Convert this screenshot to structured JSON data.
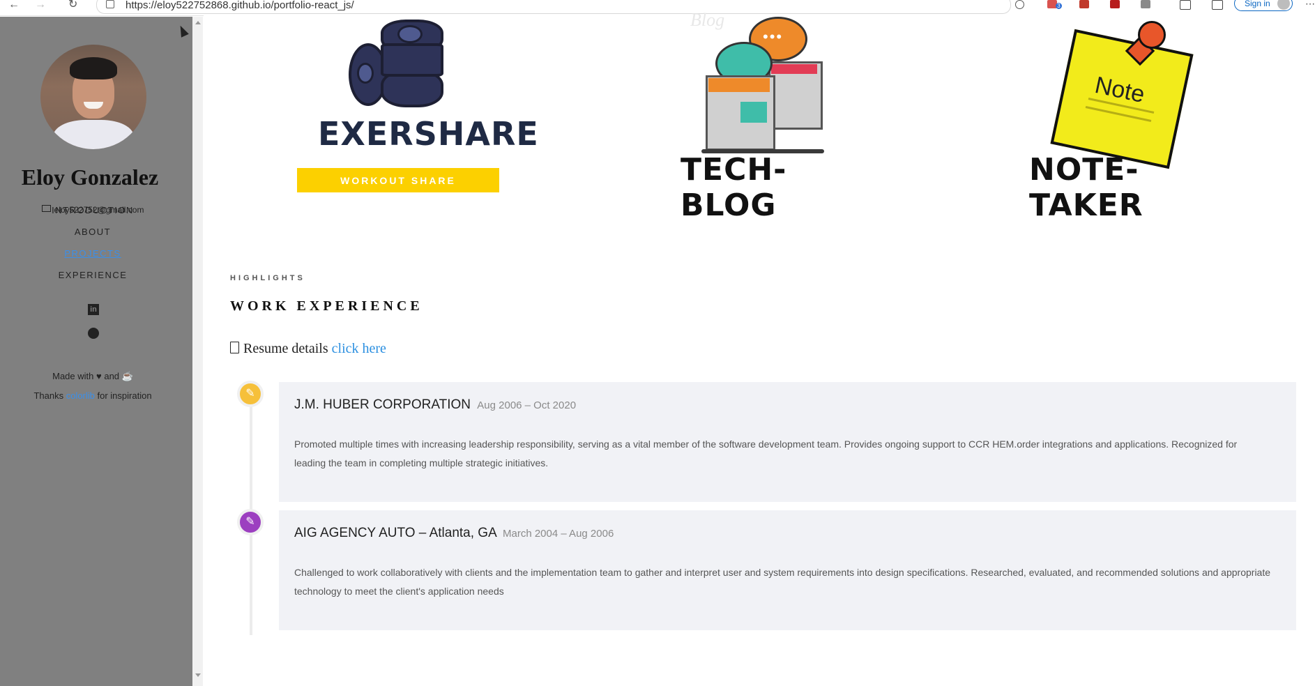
{
  "browser": {
    "url": "https://eloy522752868.github.io/portfolio-react_js/",
    "signin_label": "Sign in",
    "badge_count": "3"
  },
  "sidebar": {
    "name": "Eloy Gonzalez",
    "email": "eloy522752@gmail.com",
    "nav": [
      {
        "label": "INTRODUCTION",
        "active": false
      },
      {
        "label": "ABOUT",
        "active": false
      },
      {
        "label": "PROJECTS",
        "active": true
      },
      {
        "label": "EXPERIENCE",
        "active": false
      }
    ],
    "social": {
      "linkedin_glyph": "in",
      "github_glyph": "●"
    },
    "made_with_prefix": "Made with",
    "made_with_and": "and",
    "thanks_prefix": "Thanks",
    "thanks_link": "colorlib",
    "thanks_suffix": "for inspiration"
  },
  "projects": {
    "exershare_title": "EXERSHARE",
    "exershare_sub": "WORKOUT SHARE",
    "techblog_title": "TECH-BLOG",
    "notetaker_title": "NOTE-TAKER",
    "note_label": "Note",
    "blog_watermark": "Blog"
  },
  "experience_section": {
    "kicker": "HIGHLIGHTS",
    "title": "WORK EXPERIENCE",
    "resume_text": "Resume details",
    "resume_link": "click here",
    "entries": [
      {
        "company": "J.M. HUBER CORPORATION",
        "dates": "Aug 2006 – Oct 2020",
        "description": "Promoted multiple times with increasing leadership responsibility, serving as a vital member of the software development team. Provides ongoing support to CCR HEM.order integrations and applications. Recognized for leading the team in completing multiple strategic initiatives.",
        "icon_color": "#f6c03a",
        "icon_glyph": "✎"
      },
      {
        "company": "AIG AGENCY AUTO – Atlanta, GA",
        "dates": "March 2004 – Aug 2006",
        "description": "Challenged to work collaboratively with clients and the implementation team to gather and interpret user and system requirements into design specifications. Researched, evaluated, and recommended solutions and appropriate technology to meet the client's application needs",
        "icon_color": "#9c3fc0",
        "icon_glyph": "✎"
      }
    ]
  },
  "colors": {
    "sidebar_bg": "#808080",
    "accent_link": "#2b8fe0",
    "card_bg": "#f1f2f6"
  }
}
